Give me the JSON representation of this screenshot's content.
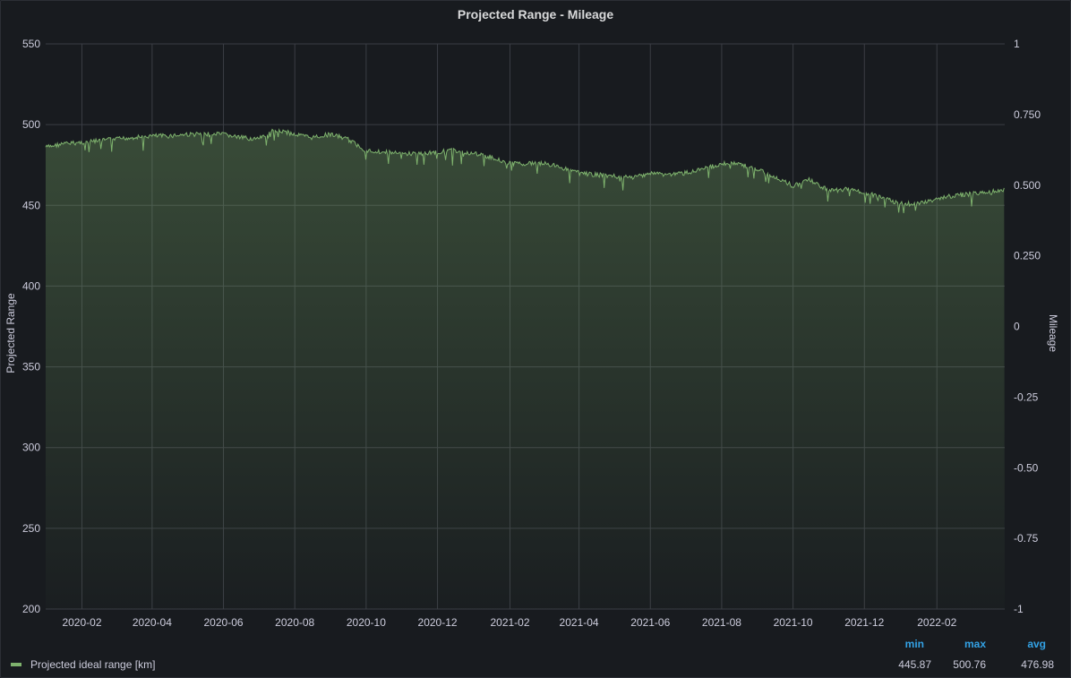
{
  "panel": {
    "title": "Projected Range - Mileage"
  },
  "legend": {
    "series_label": "Projected ideal range [km]",
    "headers": {
      "min": "min",
      "max": "max",
      "avg": "avg"
    },
    "values": {
      "min": "445.87",
      "max": "500.76",
      "avg": "476.98"
    }
  },
  "colors": {
    "series": "#7eb26d",
    "background": "#181b1f",
    "grid": "#3a3d44",
    "legend_header": "#33a2e5"
  },
  "chart_data": {
    "type": "area",
    "title": "Projected Range - Mileage",
    "xlabel": "",
    "ylabel": "Projected Range",
    "y2label": "Mileage",
    "ylim": [
      200,
      550
    ],
    "y2lim": [
      -1,
      1
    ],
    "xlim": [
      "2020-01-01",
      "2022-03-31"
    ],
    "x_ticks": [
      "2020-02",
      "2020-04",
      "2020-06",
      "2020-08",
      "2020-10",
      "2020-12",
      "2021-02",
      "2021-04",
      "2021-06",
      "2021-08",
      "2021-10",
      "2021-12",
      "2022-02"
    ],
    "y_ticks": [
      200,
      250,
      300,
      350,
      400,
      450,
      500,
      550
    ],
    "y2_ticks": [
      "-1",
      "-0.75",
      "-0.50",
      "-0.25",
      "0",
      "0.250",
      "0.500",
      "0.750",
      "1"
    ],
    "grid": true,
    "legend_position": "bottom",
    "series": [
      {
        "name": "Projected ideal range [km]",
        "x": [
          "2020-01-01",
          "2020-01-15",
          "2020-02-01",
          "2020-02-15",
          "2020-03-01",
          "2020-03-15",
          "2020-04-01",
          "2020-04-15",
          "2020-05-01",
          "2020-05-15",
          "2020-06-01",
          "2020-06-15",
          "2020-07-01",
          "2020-07-15",
          "2020-08-01",
          "2020-08-15",
          "2020-09-01",
          "2020-09-15",
          "2020-10-01",
          "2020-10-15",
          "2020-11-01",
          "2020-11-15",
          "2020-12-01",
          "2020-12-15",
          "2021-01-01",
          "2021-01-15",
          "2021-02-01",
          "2021-02-15",
          "2021-03-01",
          "2021-03-15",
          "2021-04-01",
          "2021-04-15",
          "2021-05-01",
          "2021-05-15",
          "2021-06-01",
          "2021-06-15",
          "2021-07-01",
          "2021-07-15",
          "2021-08-01",
          "2021-08-15",
          "2021-09-01",
          "2021-09-15",
          "2021-10-01",
          "2021-10-15",
          "2021-11-01",
          "2021-11-15",
          "2021-12-01",
          "2021-12-15",
          "2022-01-01",
          "2022-01-15",
          "2022-02-01",
          "2022-02-15",
          "2022-03-01",
          "2022-03-15",
          "2022-03-31"
        ],
        "values": [
          486,
          488,
          489,
          490,
          491,
          492,
          493,
          493,
          494,
          494,
          494,
          492,
          491,
          497,
          494,
          492,
          494,
          491,
          484,
          483,
          482,
          482,
          483,
          484,
          482,
          480,
          476,
          476,
          476,
          474,
          470,
          469,
          468,
          467,
          470,
          469,
          470,
          472,
          476,
          476,
          472,
          468,
          462,
          466,
          459,
          460,
          458,
          455,
          451,
          451,
          454,
          456,
          457,
          458,
          460
        ]
      }
    ]
  }
}
